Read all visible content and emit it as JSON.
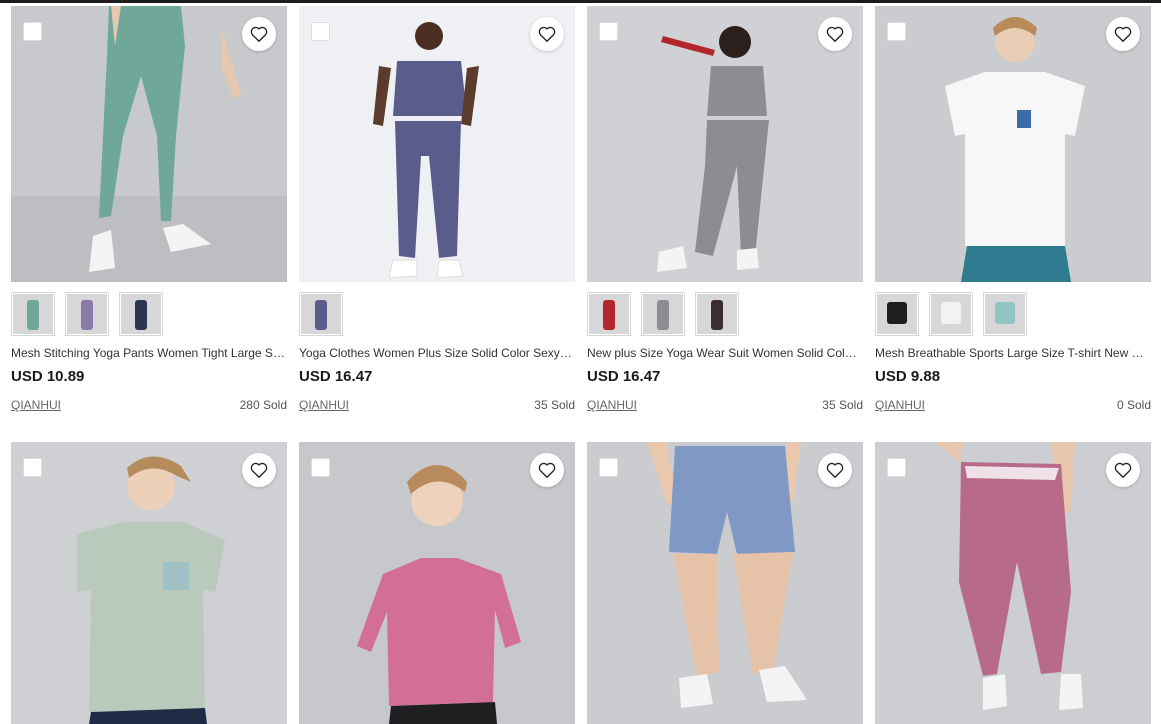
{
  "products": [
    {
      "title": "Mesh Stitching Yoga Pants Women Tight Large Size High Waist Sports Leggings",
      "price": "USD 10.89",
      "shop": "QIANHUI",
      "sold": "280 Sold",
      "garment_color": "#6fa898",
      "swatch_colors": [
        "#6fa898",
        "#8a7aa6",
        "#2d3550"
      ]
    },
    {
      "title": "Yoga Clothes Women Plus Size Solid Color Sexy Bra Leggings Set",
      "price": "USD 16.47",
      "shop": "QIANHUI",
      "sold": "35 Sold",
      "garment_color": "#5a5d8c",
      "swatch_colors": [
        "#5a5d8c"
      ]
    },
    {
      "title": "New plus Size Yoga Wear Suit Women Solid Color Zipper Top Leggings",
      "price": "USD 16.47",
      "shop": "QIANHUI",
      "sold": "35 Sold",
      "garment_color": "#8d8d91",
      "swatch_colors": [
        "#b3262c",
        "#8d8d91",
        "#3b2e33"
      ]
    },
    {
      "title": "Mesh Breathable Sports Large Size T-shirt New Quick Dry Short Sleeve",
      "price": "USD 9.88",
      "shop": "QIANHUI",
      "sold": "0 Sold",
      "garment_color": "#f7f7f7",
      "swatch_colors": [
        "#1e1e1e",
        "#f2f2f2",
        "#8fc6c4"
      ]
    },
    {
      "garment_color": "#b9c9bc"
    },
    {
      "garment_color": "#d36f97"
    },
    {
      "garment_color": "#7f98c4"
    },
    {
      "garment_color": "#b86b88"
    }
  ]
}
